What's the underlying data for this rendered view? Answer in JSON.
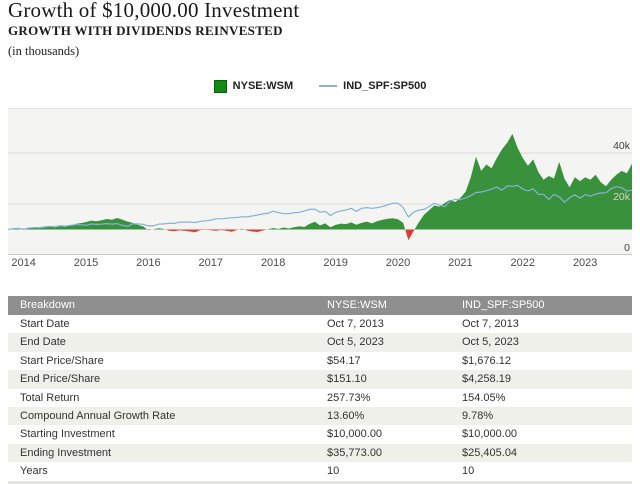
{
  "header": {
    "title": "Growth of $10,000.00 Investment",
    "subtitle": "GROWTH WITH DIVIDENDS REINVESTED",
    "units_note": "(in thousands)"
  },
  "legend": {
    "items": [
      {
        "label": "NYSE:WSM",
        "marker": "square",
        "color": "#128a12"
      },
      {
        "label": "IND_SPF:SP500",
        "marker": "line",
        "color": "#85b2d8"
      }
    ]
  },
  "colors": {
    "area_green": "#3a913c",
    "area_red": "#e03c31",
    "line_blue": "#85b2d8",
    "plot_bg": "#f4f4f2",
    "grid": "#dcdcda",
    "axis_line": "#c9c9c7",
    "tick_dark": "#3e3e3e",
    "tick_light": "#d6d2c6",
    "table_header_bg": "#8f8f8f",
    "table_alt_row": "#eef0e9"
  },
  "chart_data": {
    "type": "area",
    "title": "Growth of $10,000.00 Investment",
    "subtitle": "Growth with dividends reinvested",
    "units": "thousands of dollars",
    "baseline": 10,
    "ylim": [
      0,
      57.2
    ],
    "x_start_year": 2013.75,
    "x_interval_months": 1,
    "x_ticks": [
      2014,
      2015,
      2016,
      2017,
      2018,
      2019,
      2020,
      2021,
      2022,
      2023
    ],
    "y_ticks": [
      {
        "value": 0,
        "label": "0",
        "light": false
      },
      {
        "value": 20,
        "label": "20k",
        "light": true
      },
      {
        "value": 40,
        "label": "40k",
        "light": false
      }
    ],
    "grid": true,
    "legend_position": "top-center",
    "series": [
      {
        "name": "NYSE:WSM",
        "type": "area",
        "color_above": "#3a913c",
        "color_below": "#e03c31",
        "values": [
          10.0,
          10.4,
          10.2,
          9.9,
          10.6,
          10.9,
          10.5,
          10.8,
          11.2,
          10.8,
          11.3,
          11.1,
          11.6,
          12.2,
          12.5,
          12.9,
          13.5,
          13.2,
          13.6,
          14.1,
          13.8,
          14.5,
          13.9,
          13.1,
          12.6,
          11.8,
          11.2,
          9.7,
          10.1,
          10.5,
          10.2,
          9.5,
          9.3,
          9.7,
          9.5,
          9.2,
          8.9,
          9.8,
          9.9,
          9.7,
          9.5,
          9.8,
          9.5,
          9.1,
          9.8,
          10.3,
          9.6,
          9.2,
          9.0,
          9.6,
          10.1,
          10.6,
          10.2,
          10.8,
          10.4,
          10.9,
          11.3,
          11.0,
          12.2,
          13.0,
          11.6,
          12.4,
          10.9,
          11.8,
          12.3,
          12.1,
          12.8,
          11.9,
          12.6,
          13.1,
          12.4,
          13.3,
          13.8,
          14.2,
          14.4,
          14.0,
          12.6,
          5.8,
          9.4,
          12.8,
          15.8,
          17.6,
          19.4,
          19.0,
          20.4,
          21.6,
          20.8,
          22.4,
          24.8,
          30.5,
          38.5,
          33.0,
          35.5,
          34.0,
          38.0,
          41.5,
          44.0,
          47.5,
          42.0,
          38.0,
          35.0,
          37.5,
          32.5,
          29.5,
          31.0,
          30.0,
          36.5,
          30.0,
          26.5,
          30.5,
          29.0,
          30.5,
          29.5,
          31.5,
          28.5,
          27.0,
          29.5,
          31.5,
          33.0,
          32.0,
          35.8
        ]
      },
      {
        "name": "IND_SPF:SP500",
        "type": "line",
        "color": "#85b2d8",
        "values": [
          10.0,
          10.3,
          10.5,
          10.1,
          10.6,
          10.7,
          10.8,
          11.0,
          11.2,
          11.1,
          11.5,
          11.3,
          11.6,
          11.9,
          11.9,
          11.6,
          12.2,
          12.0,
          12.1,
          12.3,
          12.1,
          12.3,
          11.6,
          11.3,
          12.2,
          12.2,
          12.0,
          11.4,
          11.4,
          12.1,
          12.2,
          12.4,
          12.4,
          12.9,
          12.9,
          12.9,
          12.7,
          13.2,
          13.4,
          13.7,
          14.2,
          14.2,
          14.4,
          14.6,
          14.7,
          15.0,
          15.0,
          15.3,
          15.7,
          16.1,
          16.3,
          17.2,
          16.6,
          16.2,
          16.2,
          16.6,
          16.7,
          17.3,
          17.9,
          18.0,
          16.8,
          17.1,
          15.5,
          16.7,
          17.3,
          17.6,
          18.3,
          17.1,
          18.3,
          18.6,
          18.3,
          18.6,
          19.0,
          19.7,
          20.3,
          20.3,
          18.6,
          14.9,
          16.8,
          17.6,
          17.9,
          19.0,
          20.3,
          19.5,
          19.0,
          21.1,
          21.9,
          21.7,
          22.3,
          23.3,
          24.5,
          24.7,
          25.2,
          25.8,
          26.6,
          25.4,
          27.1,
          26.9,
          27.3,
          25.9,
          25.1,
          26.0,
          23.8,
          23.8,
          21.8,
          23.8,
          22.8,
          20.7,
          22.4,
          23.6,
          22.3,
          23.7,
          23.1,
          23.9,
          24.3,
          24.4,
          26.0,
          26.8,
          26.4,
          25.1,
          25.4
        ]
      }
    ]
  },
  "table": {
    "headers": [
      "Breakdown",
      "NYSE:WSM",
      "IND_SPF:SP500"
    ],
    "rows": [
      [
        "Start Date",
        "Oct 7, 2013",
        "Oct 7, 2013"
      ],
      [
        "End Date",
        "Oct 5, 2023",
        "Oct 5, 2023"
      ],
      [
        "Start Price/Share",
        "$54.17",
        "$1,676.12"
      ],
      [
        "End Price/Share",
        "$151.10",
        "$4,258.19"
      ],
      [
        "Total Return",
        "257.73%",
        "154.05%"
      ],
      [
        "Compound Annual Growth Rate",
        "13.60%",
        "9.78%"
      ],
      [
        "Starting Investment",
        "$10,000.00",
        "$10,000.00"
      ],
      [
        "Ending Investment",
        "$35,773.00",
        "$25,405.04"
      ],
      [
        "Years",
        "10",
        "10"
      ]
    ]
  }
}
